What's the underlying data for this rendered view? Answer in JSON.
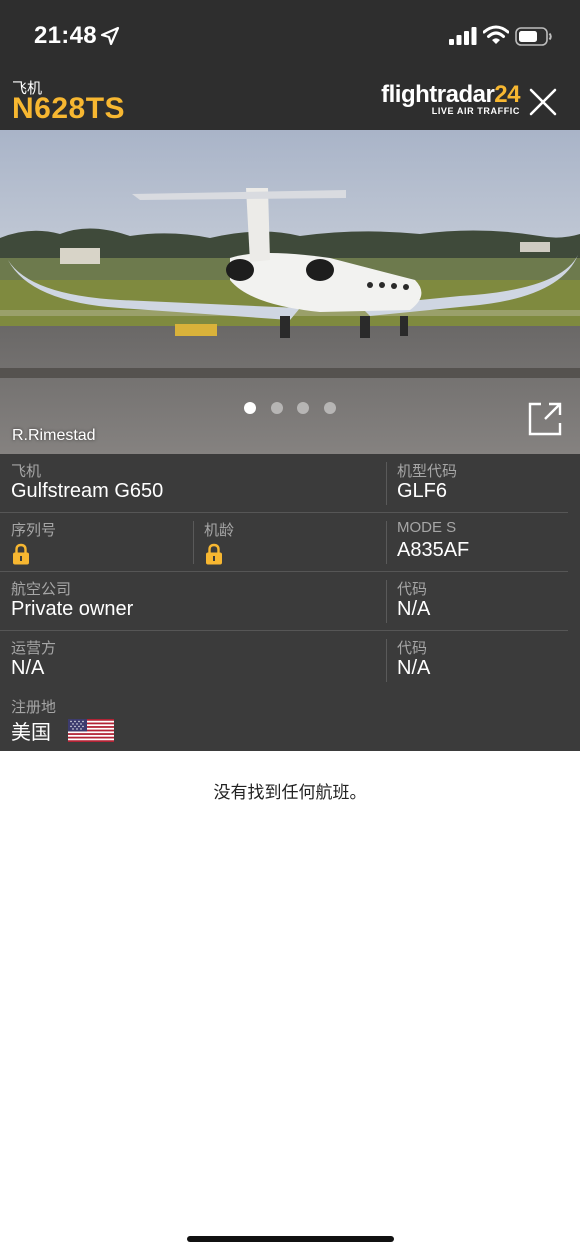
{
  "status_bar": {
    "time": "21:48"
  },
  "header": {
    "type_label": "飞机",
    "registration": "N628TS",
    "brand_name": "flightradar",
    "brand_number": "24",
    "brand_tagline": "LIVE AIR TRAFFIC"
  },
  "photo": {
    "credit": "R.Rimestad",
    "page_count": 4,
    "active_page": 1
  },
  "details": {
    "aircraft": {
      "label": "飞机",
      "value": "Gulfstream G650"
    },
    "type_code": {
      "label": "机型代码",
      "value": "GLF6"
    },
    "serial": {
      "label": "序列号",
      "locked": true
    },
    "age": {
      "label": "机龄",
      "locked": true
    },
    "mode_s": {
      "label": "MODE S",
      "value": "A835AF"
    },
    "airline": {
      "label": "航空公司",
      "value": "Private owner"
    },
    "airline_code": {
      "label": "代码",
      "value": "N/A"
    },
    "operator": {
      "label": "运营方",
      "value": "N/A"
    },
    "operator_code": {
      "label": "代码",
      "value": "N/A"
    },
    "country": {
      "label": "注册地",
      "value": "美国"
    }
  },
  "flights": {
    "empty_message": "没有找到任何航班。"
  },
  "colors": {
    "accent": "#f7b731",
    "panel": "#3b3b3b",
    "header": "#2e2e2e"
  },
  "icons": [
    "location-arrow-icon",
    "signal-icon",
    "wifi-icon",
    "battery-icon",
    "close-icon",
    "external-link-icon",
    "lock-icon",
    "us-flag-icon"
  ]
}
